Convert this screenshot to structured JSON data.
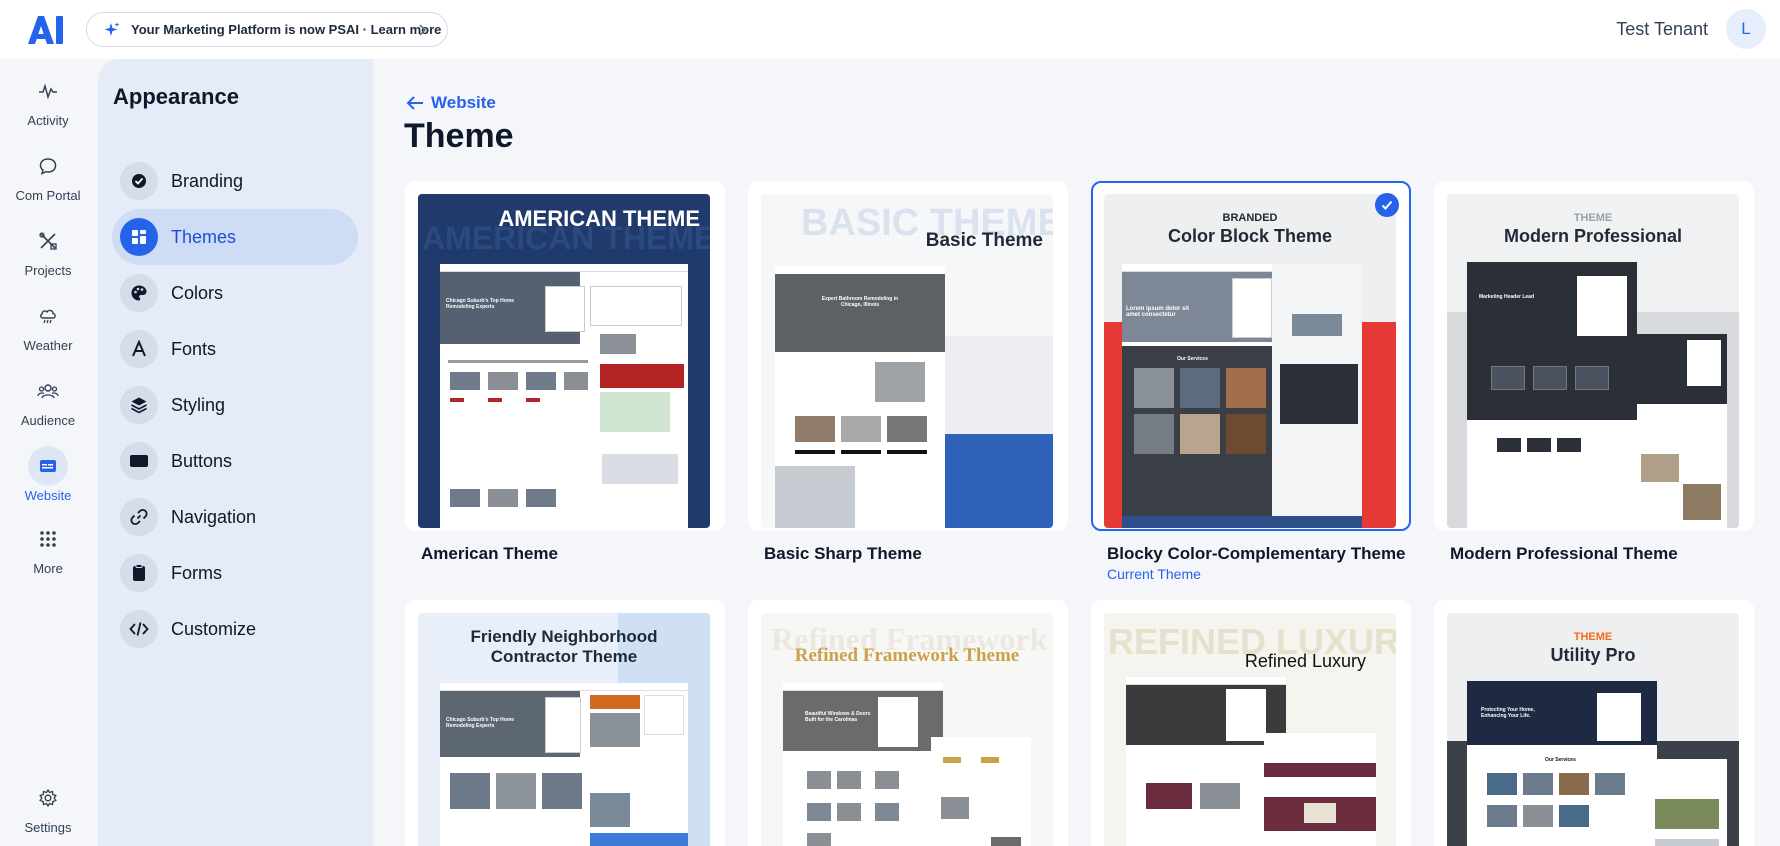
{
  "topbar": {
    "logo_text": "AI",
    "promo_text": "Your Marketing Platform is now PSAI · Learn more",
    "tenant_name": "Test Tenant",
    "avatar_initial": "L"
  },
  "rail": {
    "items": [
      {
        "label": "Activity",
        "icon": "activity-icon"
      },
      {
        "label": "Com Portal",
        "icon": "chat-bubble-icon"
      },
      {
        "label": "Projects",
        "icon": "tools-icon"
      },
      {
        "label": "Weather",
        "icon": "cloud-rain-icon"
      },
      {
        "label": "Audience",
        "icon": "users-icon"
      },
      {
        "label": "Website",
        "icon": "browser-icon",
        "active": true
      },
      {
        "label": "More",
        "icon": "grid-dots-icon"
      }
    ],
    "settings_label": "Settings"
  },
  "panel": {
    "title": "Appearance",
    "items": [
      {
        "label": "Branding",
        "icon": "badge-check-icon"
      },
      {
        "label": "Themes",
        "icon": "layout-grid-icon",
        "active": true
      },
      {
        "label": "Colors",
        "icon": "palette-icon"
      },
      {
        "label": "Fonts",
        "icon": "font-a-icon"
      },
      {
        "label": "Styling",
        "icon": "layers-icon"
      },
      {
        "label": "Buttons",
        "icon": "button-rect-icon"
      },
      {
        "label": "Navigation",
        "icon": "link-icon"
      },
      {
        "label": "Forms",
        "icon": "clipboard-icon"
      },
      {
        "label": "Customize",
        "icon": "code-icon"
      }
    ]
  },
  "main": {
    "back_label": "Website",
    "title": "Theme",
    "themes": [
      {
        "name": "American Theme",
        "thumb_title": "AMERICAN THEME",
        "thumb_watermark": "AMERICAN THEME",
        "thumb_small": "Chicago Suburb's Top Home Remodeling Experts"
      },
      {
        "name": "Basic Sharp Theme",
        "thumb_title": "Basic Theme",
        "thumb_watermark": "BASIC THEME",
        "thumb_small": "Expert Bathroom Remodeling in Chicago, Illinois"
      },
      {
        "name": "Blocky Color-Complementary Theme",
        "thumb_kicker": "BRANDED",
        "thumb_title": "Color Block Theme",
        "thumb_small": "Lorem ipsum dolor sit amet consectetur",
        "thumb_section": "Our Services",
        "current_label": "Current Theme",
        "selected": true
      },
      {
        "name": "Modern Professional Theme",
        "thumb_kicker": "THEME",
        "thumb_title": "Modern Professional",
        "thumb_small": "Marketing Header Lead"
      },
      {
        "name": "Friendly Neighborhood Contractor Theme",
        "thumb_title_1": "Friendly Neighborhood",
        "thumb_title_2": "Contractor Theme",
        "thumb_small": "Chicago Suburb's Top Home Remodeling Experts"
      },
      {
        "name": "Refined Framework Theme",
        "thumb_title": "Refined Framework Theme",
        "thumb_watermark": "Refined Framework",
        "thumb_small": "Beautiful Windows & Doors Built for the Carolinas"
      },
      {
        "name": "Refined Luxury",
        "thumb_title": "Refined Luxury",
        "thumb_watermark": "REFINED LUXURY"
      },
      {
        "name": "Utility Pro",
        "thumb_kicker": "THEME",
        "thumb_title": "Utility Pro",
        "thumb_small": "Protecting Your Home, Enhancing Your Life.",
        "thumb_section": "Our Services"
      }
    ]
  },
  "colors": {
    "accent": "#2563eb",
    "american_navy": "#1f3a6b",
    "color_block_red": "#e53935",
    "modern_dark": "#2b2f38",
    "friendly_orange": "#d2691e",
    "refined_gold": "#c9a24a",
    "luxury_maroon": "#6b2c3e",
    "utility_orange": "#f26b1d"
  }
}
